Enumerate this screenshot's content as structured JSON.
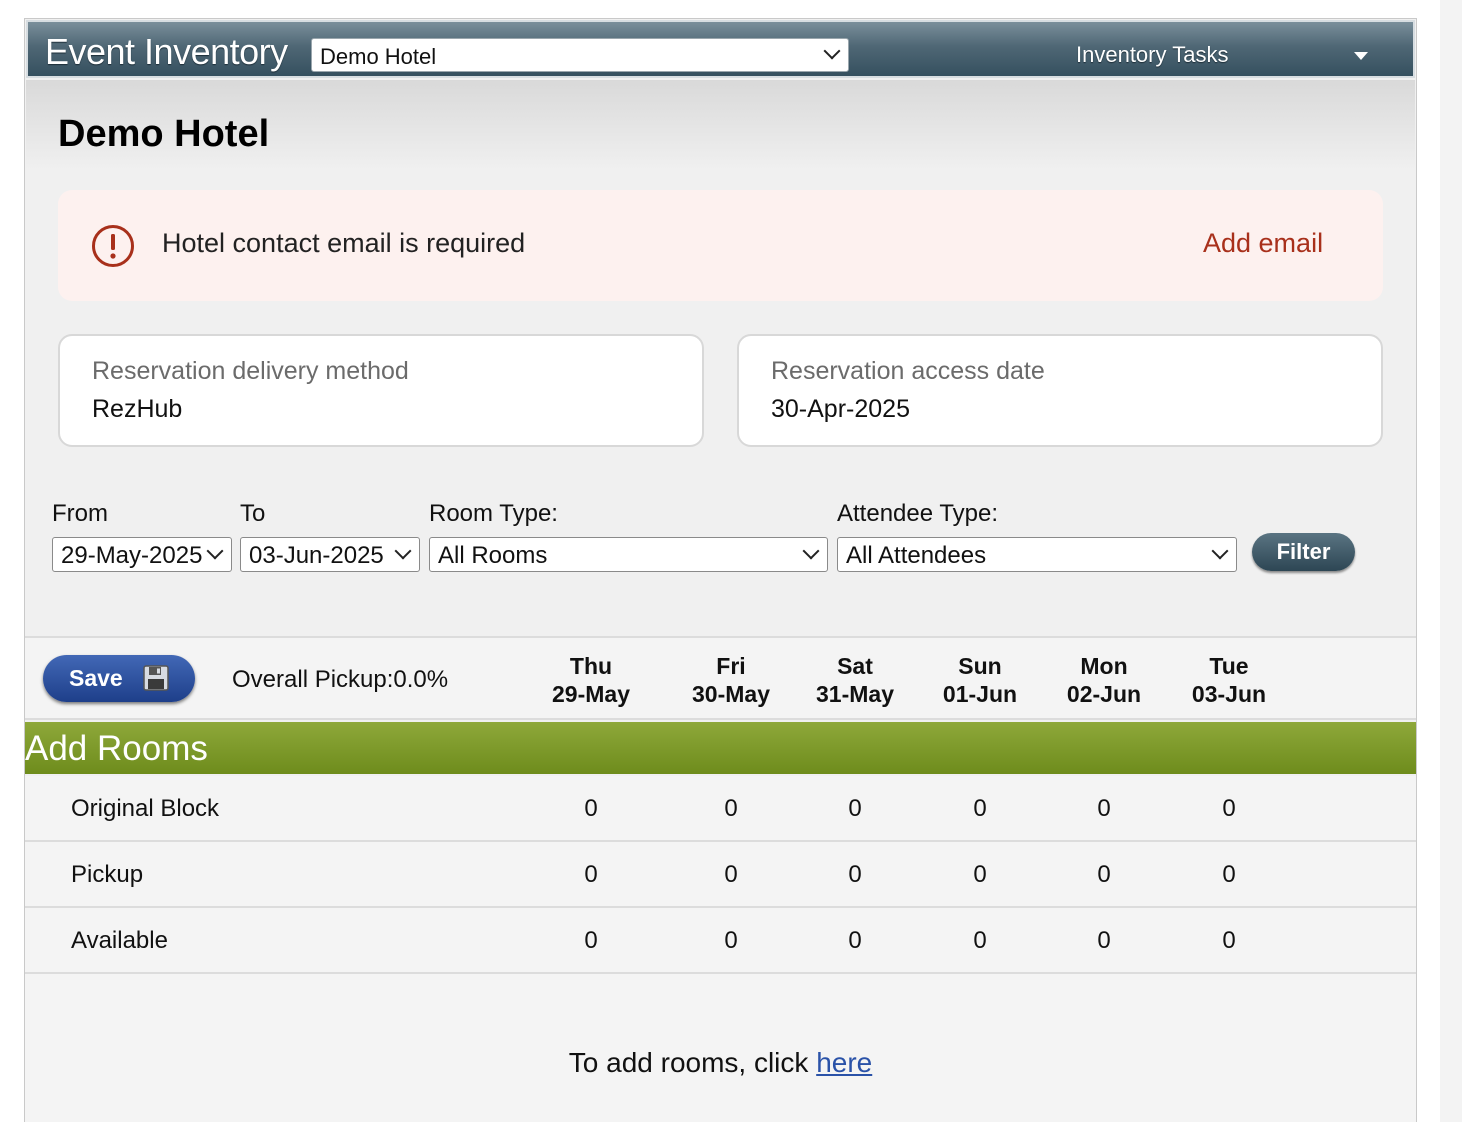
{
  "header": {
    "app_title": "Event Inventory",
    "hotel_select_value": "Demo Hotel",
    "tasks_label": "Inventory Tasks"
  },
  "page": {
    "title": "Demo Hotel"
  },
  "alert": {
    "message": "Hotel contact email is required",
    "action_label": "Add email"
  },
  "cards": {
    "delivery": {
      "label": "Reservation delivery method",
      "value": "RezHub"
    },
    "access": {
      "label": "Reservation access date",
      "value": "30-Apr-2025"
    }
  },
  "filters": {
    "from_label": "From",
    "from_value": "29-May-2025",
    "to_label": "To",
    "to_value": "03-Jun-2025",
    "room_type_label": "Room Type:",
    "room_type_value": "All Rooms",
    "attendee_type_label": "Attendee Type:",
    "attendee_type_value": "All Attendees",
    "filter_button": "Filter"
  },
  "grid": {
    "save_label": "Save",
    "overall_pickup": "Overall Pickup:0.0%",
    "days": [
      {
        "dow": "Thu",
        "date": "29-May"
      },
      {
        "dow": "Fri",
        "date": "30-May"
      },
      {
        "dow": "Sat",
        "date": "31-May"
      },
      {
        "dow": "Sun",
        "date": "01-Jun"
      },
      {
        "dow": "Mon",
        "date": "02-Jun"
      },
      {
        "dow": "Tue",
        "date": "03-Jun"
      }
    ],
    "section_title": "Add Rooms",
    "rows": [
      {
        "label": "Original Block",
        "values": [
          "0",
          "0",
          "0",
          "0",
          "0",
          "0"
        ]
      },
      {
        "label": "Pickup",
        "values": [
          "0",
          "0",
          "0",
          "0",
          "0",
          "0"
        ]
      },
      {
        "label": "Available",
        "values": [
          "0",
          "0",
          "0",
          "0",
          "0",
          "0"
        ]
      }
    ],
    "hint_prefix": "To add rooms, click ",
    "hint_link": "here"
  },
  "colors": {
    "alert_accent": "#a8301b",
    "section_green": "#7f9a2a",
    "save_blue": "#2a4f9e",
    "header_slate": "#4f6775",
    "link_blue": "#2a52a8"
  }
}
